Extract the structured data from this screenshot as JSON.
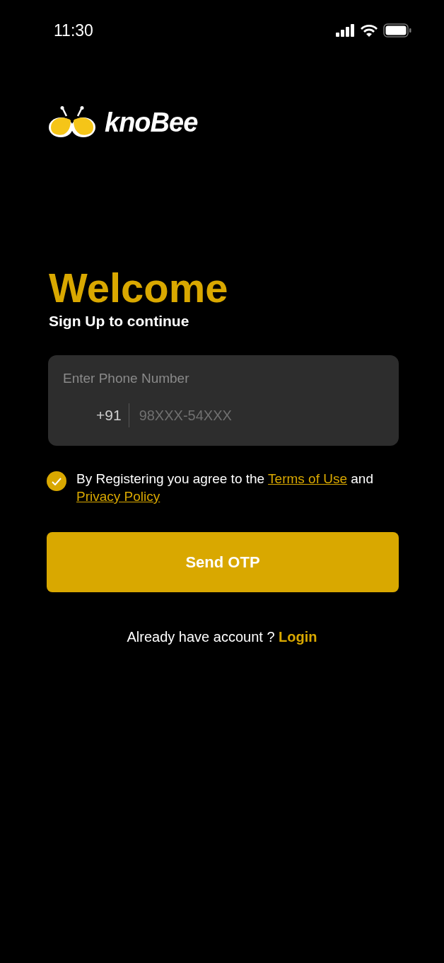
{
  "status_bar": {
    "time": "11:30"
  },
  "brand": {
    "name": "knoBee"
  },
  "heading": {
    "title": "Welcome",
    "subtitle": "Sign Up to continue"
  },
  "phone_field": {
    "label": "Enter Phone Number",
    "country_code": "+91",
    "placeholder": "98XXX-54XXX"
  },
  "consent": {
    "checked": true,
    "text": "By Registering you agree to the",
    "link_1": "Terms of Use",
    "joiner": "and",
    "link_2": "Privacy Policy"
  },
  "submit": {
    "label": "Send OTP"
  },
  "footer": {
    "text": "Already have account ?",
    "link": "Login"
  }
}
